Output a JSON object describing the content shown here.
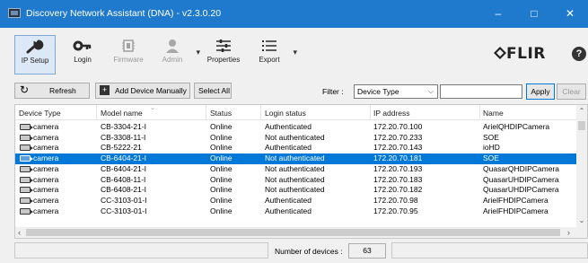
{
  "window": {
    "title": "Discovery Network Assistant (DNA) - v2.3.0.20",
    "controls": [
      "–",
      "□",
      "✕"
    ]
  },
  "toolbar": {
    "buttons": [
      {
        "label": "IP Setup",
        "icon": "wrench-icon",
        "state": "active"
      },
      {
        "label": "Login",
        "icon": "key-icon",
        "state": "enabled"
      },
      {
        "label": "Firmware",
        "icon": "chip-icon",
        "state": "disabled"
      },
      {
        "label": "Admin",
        "icon": "user-icon",
        "state": "disabled"
      },
      {
        "label": "Properties",
        "icon": "sliders-icon",
        "state": "enabled"
      },
      {
        "label": "Export",
        "icon": "list-icon",
        "state": "enabled"
      }
    ],
    "brand": "FLIR",
    "help": "?"
  },
  "actions": {
    "refresh": "Refresh",
    "add_device": "Add Device Manually",
    "select_all": "Select All",
    "filter_label": "Filter :",
    "filter_selected": "Device Type",
    "filter_value": "",
    "apply": "Apply",
    "clear": "Clear"
  },
  "table": {
    "columns": [
      "Device Type",
      "Model name",
      "Status",
      "Login status",
      "IP address",
      "Name"
    ],
    "rows": [
      [
        "camera",
        "CB-3304-21-I",
        "Online",
        "Authenticated",
        "172.20.70.100",
        "ArielQHDIPCamera"
      ],
      [
        "camera",
        "CB-3308-11-I",
        "Online",
        "Not authenticated",
        "172.20.70.233",
        "SOE"
      ],
      [
        "camera",
        "CB-5222-21",
        "Online",
        "Authenticated",
        "172.20.70.143",
        "ioHD"
      ],
      [
        "camera",
        "CB-6404-21-I",
        "Online",
        "Not authenticated",
        "172.20.70.181",
        "SOE"
      ],
      [
        "camera",
        "CB-6404-21-I",
        "Online",
        "Not authenticated",
        "172.20.70.193",
        "QuasarQHDIPCamera"
      ],
      [
        "camera",
        "CB-6408-11-I",
        "Online",
        "Not authenticated",
        "172.20.70.183",
        "QuasarUHDIPCamera"
      ],
      [
        "camera",
        "CB-6408-21-I",
        "Online",
        "Not authenticated",
        "172.20.70.182",
        "QuasarUHDIPCamera"
      ],
      [
        "camera",
        "CC-3103-01-I",
        "Online",
        "Authenticated",
        "172.20.70.98",
        "ArielFHDIPCamera"
      ],
      [
        "camera",
        "CC-3103-01-I",
        "Online",
        "Authenticated",
        "172.20.70.95",
        "ArielFHDIPCamera"
      ]
    ],
    "selected_row_index": 3
  },
  "status": {
    "count_label": "Number of devices :",
    "count_value": "63"
  },
  "colors": {
    "titlebar": "#1f79cd",
    "selection": "#0078d7"
  }
}
